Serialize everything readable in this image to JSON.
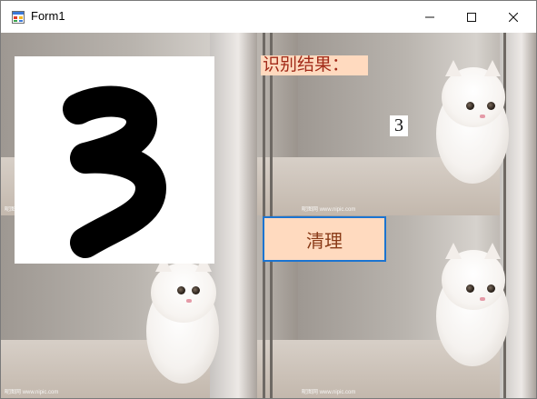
{
  "window": {
    "title": "Form1",
    "controls": {
      "minimize": "minimize-icon",
      "maximize": "maximize-icon",
      "close": "close-icon"
    }
  },
  "labels": {
    "result_caption": "识别结果：",
    "result_value": "3"
  },
  "buttons": {
    "clear_label": "清理"
  },
  "background": {
    "watermark": "昵图网 www.nipic.com"
  },
  "colors": {
    "label_background": "#ffdabf",
    "caption_text": "#a12a18",
    "button_border": "#1b74d1"
  }
}
